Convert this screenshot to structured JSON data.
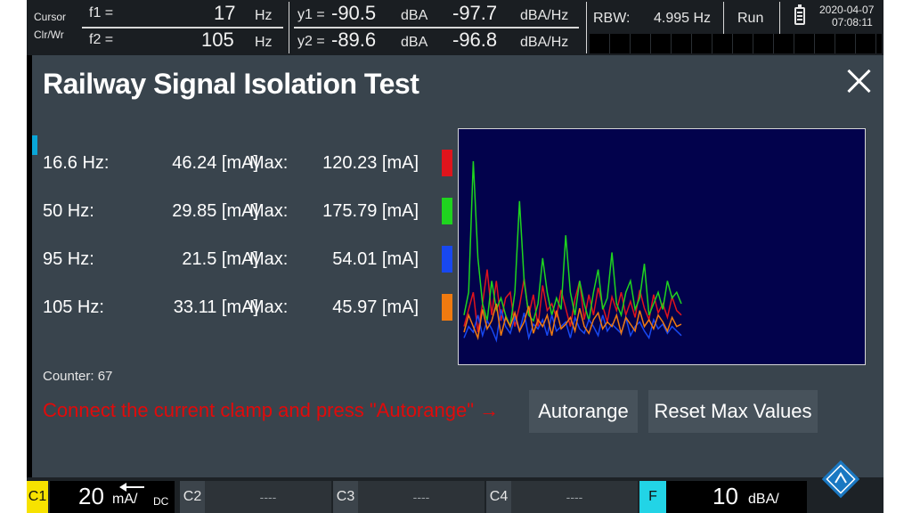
{
  "topbar": {
    "cursor_label": "Cursor",
    "clrwr_label": "Clr/Wr",
    "f1_label": "f1 =",
    "f1_value": "17",
    "f1_unit": "Hz",
    "f2_label": "f2 =",
    "f2_value": "105",
    "f2_unit": "Hz",
    "y1_label": "y1 =",
    "y1_value": "-90.5",
    "y1_unit": "dBA",
    "y1_density": "-97.7",
    "y1_density_unit": "dBA/Hz",
    "y2_label": "y2 =",
    "y2_value": "-89.6",
    "y2_unit": "dBA",
    "y2_density": "-96.8",
    "y2_density_unit": "dBA/Hz",
    "rbw_label": "RBW:",
    "rbw_value": "4.995 Hz",
    "run_label": "Run",
    "date": "2020-04-07",
    "time": "07:08:11"
  },
  "dialog": {
    "title": "Railway Signal Isolation Test",
    "rows": [
      {
        "freq": "16.6 Hz:",
        "value": "46.24 [mA]",
        "max_label": "Max:",
        "max_value": "120.23 [mA]",
        "color": "#e0141c"
      },
      {
        "freq": "50 Hz:",
        "value": "29.85 [mA]",
        "max_label": "Max:",
        "max_value": "175.79 [mA]",
        "color": "#1fd41f"
      },
      {
        "freq": "95 Hz:",
        "value": "21.5 [mA]",
        "max_label": "Max:",
        "max_value": "54.01 [mA]",
        "color": "#1848f0"
      },
      {
        "freq": "105 Hz:",
        "value": "33.11 [mA]",
        "max_label": "Max:",
        "max_value": "45.97 [mA]",
        "color": "#f07a10"
      }
    ],
    "counter": "Counter: 67",
    "hint": "Connect the current clamp and press \"Autorange\" →",
    "autorange_label": "Autorange",
    "reset_label": "Reset Max Values"
  },
  "bottombar": {
    "c1_label": "C1",
    "c1_value": "20",
    "c1_unit": "mA/",
    "c1_coupling": "DC",
    "c2_label": "C2",
    "c2_value": "----",
    "c3_label": "C3",
    "c3_value": "----",
    "c4_label": "C4",
    "c4_value": "----",
    "f_label": "F",
    "f_value": "10",
    "f_unit": "dBA/"
  },
  "chart_data": {
    "type": "line",
    "samples": 48,
    "ylim": [
      0,
      200
    ],
    "series": [
      {
        "color": "#e0141c",
        "values": [
          30,
          45,
          60,
          25,
          50,
          80,
          40,
          70,
          35,
          55,
          60,
          30,
          48,
          72,
          40,
          58,
          30,
          66,
          44,
          50,
          38,
          62,
          46,
          30,
          54,
          70,
          36,
          58,
          40,
          64,
          48,
          34,
          56,
          44,
          60,
          40,
          52,
          38,
          62,
          46,
          36,
          58,
          42,
          50,
          38,
          56,
          44,
          40
        ]
      },
      {
        "color": "#1fd41f",
        "values": [
          40,
          60,
          175,
          90,
          50,
          35,
          70,
          45,
          55,
          40,
          30,
          60,
          140,
          70,
          40,
          35,
          50,
          90,
          60,
          40,
          55,
          45,
          110,
          60,
          40,
          70,
          50,
          35,
          60,
          80,
          45,
          55,
          95,
          50,
          40,
          60,
          70,
          45,
          55,
          85,
          40,
          50,
          60,
          45,
          70,
          55,
          60,
          50
        ]
      },
      {
        "color": "#1848f0",
        "values": [
          20,
          30,
          25,
          40,
          22,
          35,
          28,
          18,
          45,
          30,
          24,
          38,
          26,
          42,
          20,
          32,
          28,
          36,
          22,
          40,
          26,
          30,
          34,
          20,
          38,
          28,
          24,
          36,
          30,
          22,
          40,
          26,
          32,
          28,
          24,
          38,
          22,
          30,
          34,
          26,
          20,
          36,
          28,
          32,
          24,
          30,
          26,
          22
        ]
      },
      {
        "color": "#f07a10",
        "values": [
          25,
          40,
          30,
          20,
          45,
          28,
          35,
          50,
          22,
          38,
          30,
          42,
          26,
          34,
          48,
          24,
          36,
          30,
          40,
          22,
          44,
          28,
          32,
          38,
          26,
          46,
          30,
          24,
          36,
          42,
          28,
          34,
          30,
          40,
          24,
          38,
          32,
          26,
          44,
          30,
          36,
          28,
          40,
          34,
          26,
          38,
          30,
          32
        ]
      }
    ]
  }
}
